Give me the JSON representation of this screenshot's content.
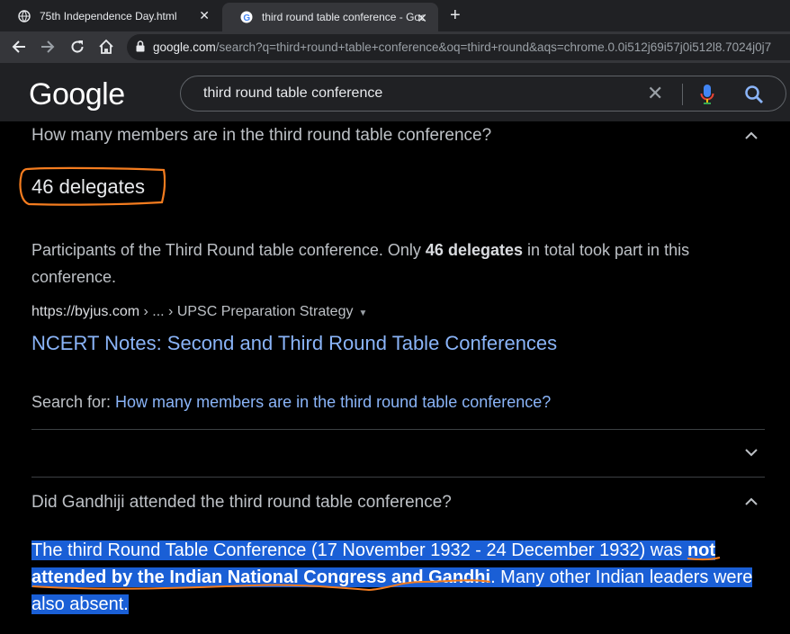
{
  "tabs": [
    {
      "title": "75th Independence Day.html",
      "close": "✕"
    },
    {
      "title": "third round table conference - Google Search",
      "close": "✕"
    }
  ],
  "new_tab": "+",
  "address": {
    "host": "google.com",
    "path": "/search?q=third+round+table+conference&oq=third+round&aqs=chrome.0.0i512j69i57j0i512l8.7024j0j7"
  },
  "google": {
    "logo": "Google",
    "query": "third round table conference",
    "clear_icon": "✕"
  },
  "faq1": {
    "question": "How many members are in the third round table conference?",
    "answer": "46 delegates",
    "para_pre": "Participants of the Third Round table conference. Only ",
    "para_bold": "46 delegates",
    "para_post": " in total took part in this conference.",
    "cite_host": "https://byjus.com",
    "cite_path": " › ... › UPSC Preparation Strategy",
    "cite_tri": "▼",
    "link_title": "NCERT Notes: Second and Third Round Table Conferences",
    "search_for_label": "Search for: ",
    "search_for_link": "How many members are in the third round table conference?"
  },
  "faq2": {
    "question": "Did Gandhiji attended the third round table conference?",
    "pre": "The third Round Table Conference (17 November 1932 - 24 December 1932) was ",
    "bold": "not attended by the Indian National Congress and Gandhi",
    "post": ". Many other Indian leaders were also absent."
  },
  "colors": {
    "link": "#8ab4f8",
    "selection": "#1a5fd6",
    "annotation": "#f47c1f"
  }
}
